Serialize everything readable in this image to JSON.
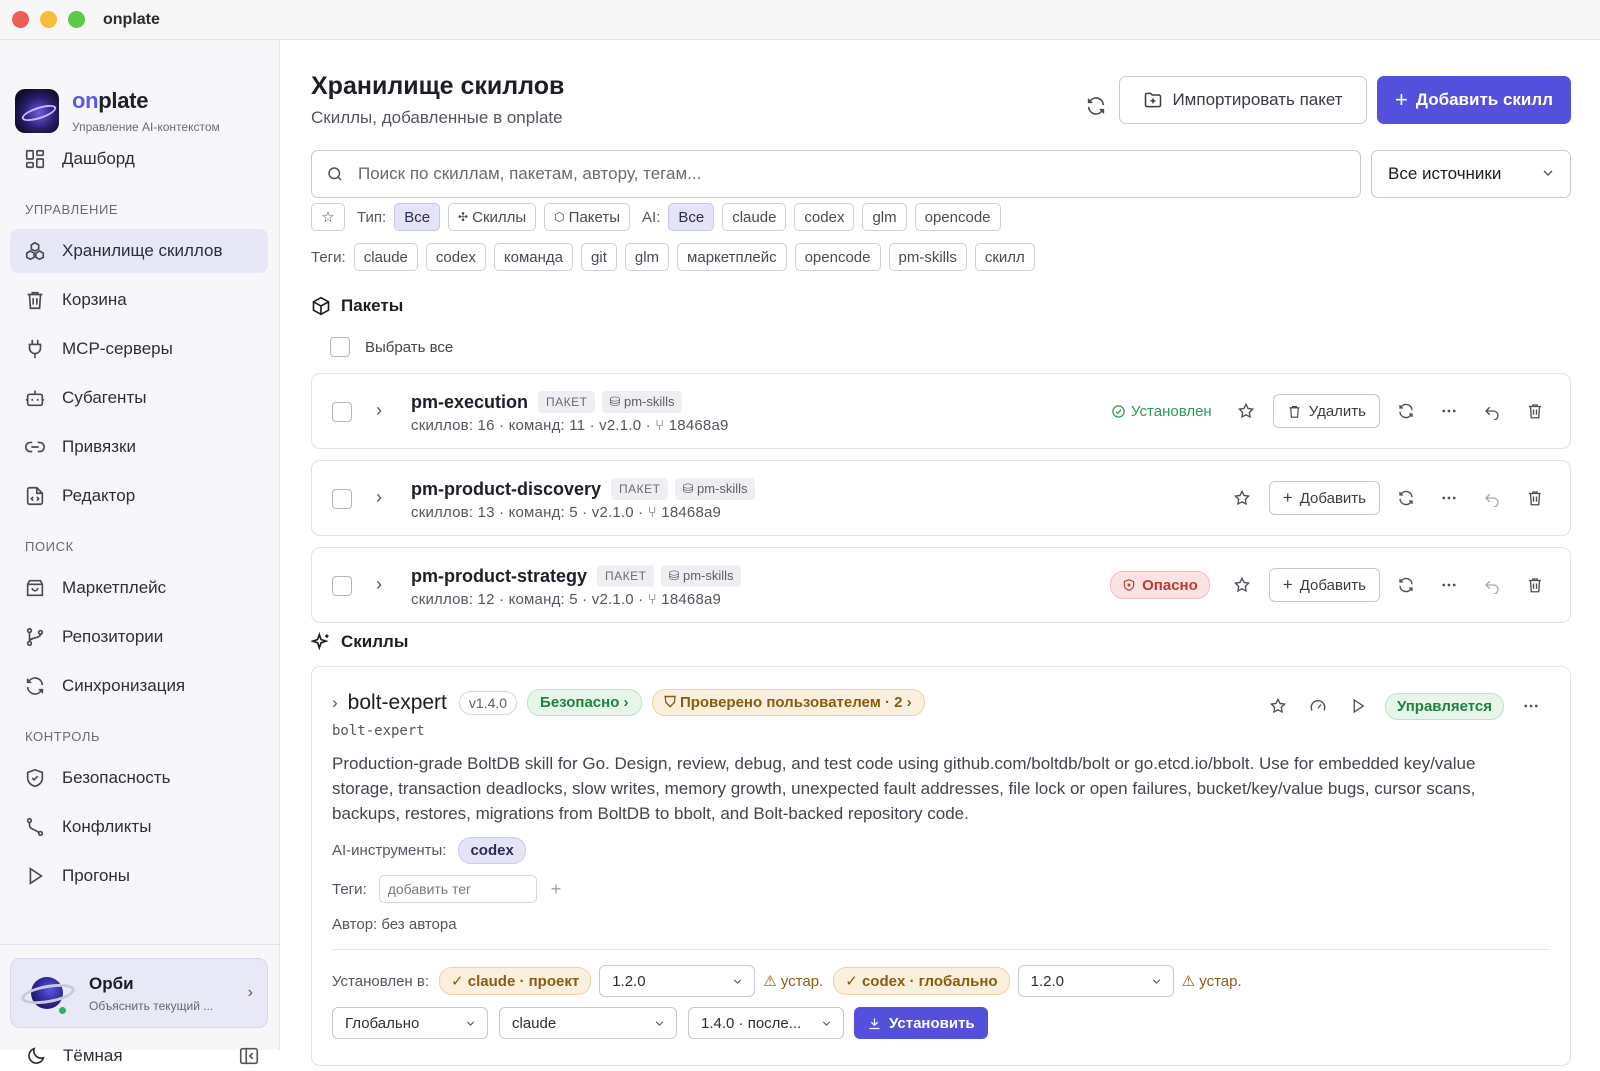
{
  "window": {
    "title": "onplate"
  },
  "brand": {
    "name_a": "on",
    "name_b": "plate",
    "subtitle": "Управление AI-контекстом"
  },
  "nav": {
    "dashboard": "Дашборд",
    "section_manage": "УПРАВЛЕНИЕ",
    "skills_store": "Хранилище скиллов",
    "trash": "Корзина",
    "mcp": "MCP-серверы",
    "subagents": "Субагенты",
    "bindings": "Привязки",
    "editor": "Редактор",
    "section_search": "ПОИСК",
    "marketplace": "Маркетплейс",
    "repos": "Репозитории",
    "sync": "Синхронизация",
    "section_control": "КОНТРОЛЬ",
    "security": "Безопасность",
    "conflicts": "Конфликты",
    "runs": "Прогоны"
  },
  "orbi": {
    "name": "Орби",
    "subtitle": "Объяснить текущий ..."
  },
  "theme": {
    "label": "Тёмная"
  },
  "header": {
    "title": "Хранилище скиллов",
    "subtitle": "Скиллы, добавленные в onplate",
    "import_label": "Импортировать пакет",
    "add_label": "Добавить скилл"
  },
  "search": {
    "placeholder": "Поиск по скиллам, пакетам, автору, тегам...",
    "source": "Все источники"
  },
  "filters": {
    "type_label": "Тип:",
    "type_all": "Все",
    "type_skills": "Скиллы",
    "type_packages": "Пакеты",
    "ai_label": "AI:",
    "ai_all": "Все",
    "ai_options": [
      "claude",
      "codex",
      "glm",
      "opencode"
    ],
    "tags_label": "Теги:",
    "tags": [
      "claude",
      "codex",
      "команда",
      "git",
      "glm",
      "маркетплейс",
      "opencode",
      "pm-skills",
      "скилл"
    ]
  },
  "packages": {
    "title": "Пакеты",
    "select_all": "Выбрать все",
    "badge": "ПАКЕТ",
    "items": [
      {
        "name": "pm-execution",
        "source": "pm-skills",
        "meta": "скиллов: 16 · команд: 11  · v2.1.0  · ⑂ 18468a9",
        "status": "Установлен",
        "action": "Удалить"
      },
      {
        "name": "pm-product-discovery",
        "source": "pm-skills",
        "meta": "скиллов: 13 · команд: 5  · v2.1.0  · ⑂ 18468a9",
        "status": "",
        "action": "Добавить"
      },
      {
        "name": "pm-product-strategy",
        "source": "pm-skills",
        "meta": "скиллов: 12 · команд: 5  · v2.1.0  · ⑂ 18468a9",
        "status": "Опасно",
        "action": "Добавить"
      }
    ]
  },
  "skills": {
    "title": "Скиллы",
    "item": {
      "name": "bolt-expert",
      "version": "v1.4.0",
      "safe": "Безопасно ›",
      "verified": "Проверено пользователем · 2 ›",
      "managed": "Управляется",
      "id": "bolt-expert",
      "description": "Production-grade BoltDB skill for Go. Design, review, debug, and test code using github.com/boltdb/bolt or go.etcd.io/bbolt. Use for embedded key/value storage, transaction deadlocks, slow writes, memory growth, unexpected fault addresses, file lock or open failures, bucket/key/value bugs, cursor scans, backups, restores, migrations from BoltDB to bbolt, and Bolt-backed repository code.",
      "ai_label": "AI-инструменты:",
      "ai_tool": "codex",
      "tags_label": "Теги:",
      "tag_placeholder": "добавить тег",
      "author": "Автор: без автора",
      "installed_label": "Установлен в:",
      "install_1": "claude · проект",
      "install_1_ver": "1.2.0",
      "outdated": "устар.",
      "install_2": "codex · глобально",
      "install_2_ver": "1.2.0",
      "scope": "Глобально",
      "target": "claude",
      "target_ver": "1.4.0 · после...",
      "install_btn": "Установить"
    }
  }
}
